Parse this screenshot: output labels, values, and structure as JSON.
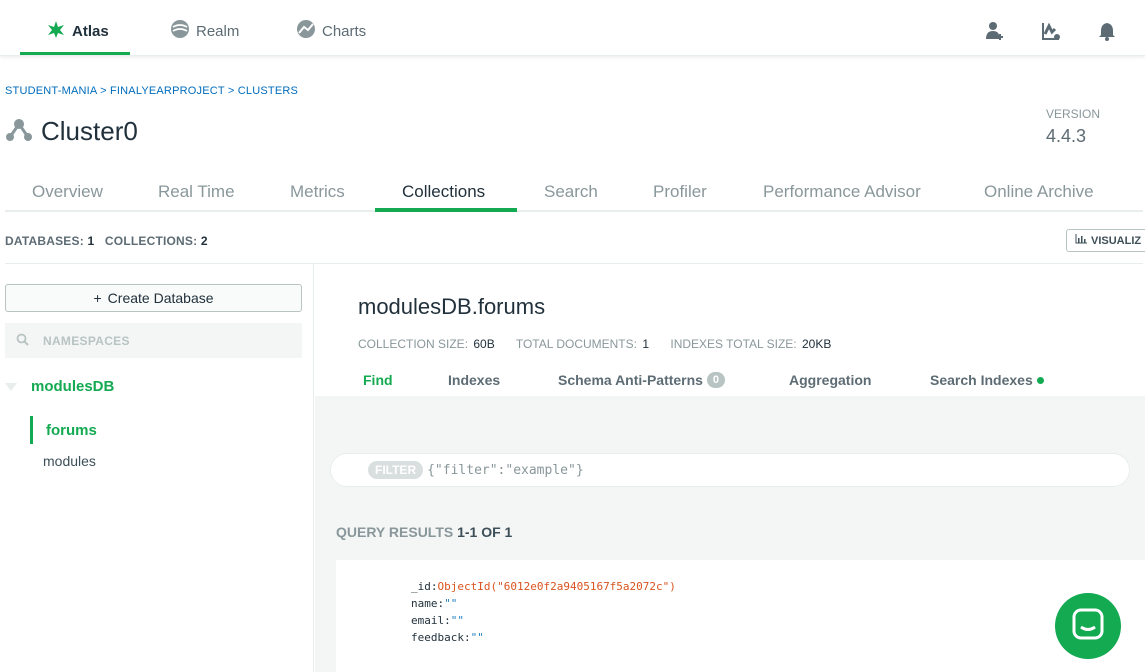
{
  "topnav": {
    "items": [
      {
        "label": "Atlas",
        "icon": "leaf-icon"
      },
      {
        "label": "Realm",
        "icon": "realm-icon"
      },
      {
        "label": "Charts",
        "icon": "charts-icon"
      }
    ],
    "right_icons": [
      "add-user-icon",
      "activity-icon",
      "bell-icon"
    ]
  },
  "breadcrumb": "STUDENT-MANIA > FINALYEARPROJECT > CLUSTERS",
  "cluster": {
    "name": "Cluster0",
    "version_label": "VERSION",
    "version": "4.4.3"
  },
  "tabs": [
    "Overview",
    "Real Time",
    "Metrics",
    "Collections",
    "Search",
    "Profiler",
    "Performance Advisor",
    "Online Archive"
  ],
  "active_tab": "Collections",
  "counts": {
    "databases_label": "DATABASES:",
    "databases": "1",
    "collections_label": "COLLECTIONS:",
    "collections": "2"
  },
  "visualize_label": "VISUALIZ",
  "sidebar": {
    "create_db_label": "Create Database",
    "namespace_placeholder": "NAMESPACES",
    "database": "modulesDB",
    "collections": [
      "forums",
      "modules"
    ],
    "active_collection": "forums"
  },
  "collection": {
    "title": "modulesDB.forums",
    "stats": [
      {
        "label": "COLLECTION SIZE:",
        "value": "60B"
      },
      {
        "label": "TOTAL DOCUMENTS:",
        "value": "1"
      },
      {
        "label": "INDEXES TOTAL SIZE:",
        "value": "20KB"
      }
    ],
    "subtabs": [
      {
        "label": "Find"
      },
      {
        "label": "Indexes"
      },
      {
        "label": "Schema Anti-Patterns",
        "badge": "0"
      },
      {
        "label": "Aggregation"
      },
      {
        "label": "Search Indexes"
      }
    ]
  },
  "filter": {
    "pill": "FILTER",
    "placeholder": "{\"filter\":\"example\"}"
  },
  "query_results": {
    "label": "QUERY RESULTS",
    "range": "1-1 OF 1"
  },
  "document": [
    {
      "key": "_id:",
      "value": "ObjectId(\"6012e0f2a9405167f5a2072c\")"
    },
    {
      "key": "name:",
      "value": "\"\""
    },
    {
      "key": "email:",
      "value": "\"\""
    },
    {
      "key": "feedback:",
      "value": "\"\""
    }
  ],
  "colors": {
    "brand_green": "#13aa52",
    "link_blue": "#006cbc",
    "oid_orange": "#d9531e"
  }
}
